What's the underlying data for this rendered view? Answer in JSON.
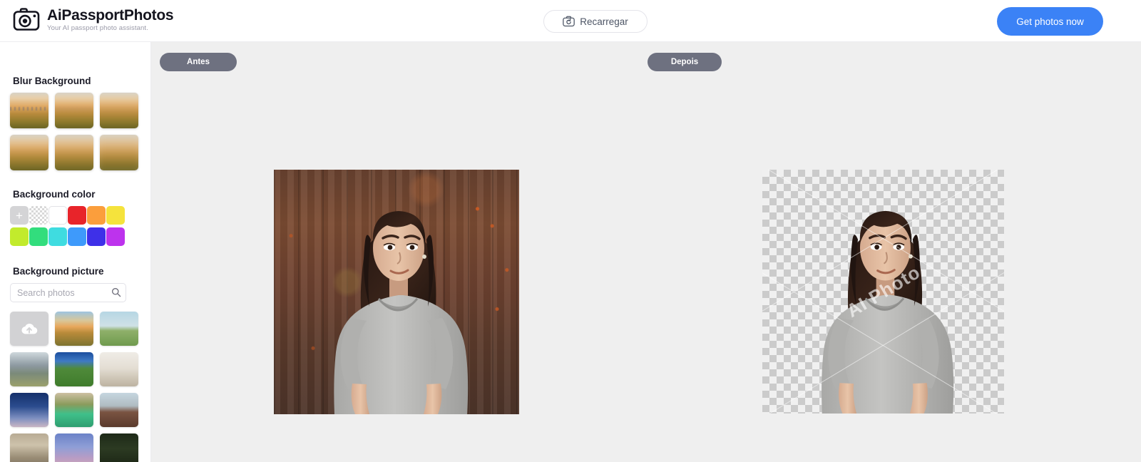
{
  "header": {
    "brand_title": "AiPassportPhotos",
    "brand_subtitle": "Your AI passport photo assistant.",
    "logo_icon": "camera-icon",
    "reload_label": "Recarregar",
    "reload_icon": "camera-refresh-icon",
    "cta_label": "Get photos now",
    "cta_color": "#3b82f6"
  },
  "sidebar": {
    "blur_section": {
      "title": "Blur Background",
      "thumbnails": [
        {
          "name": "blur-level-1",
          "blur": "0"
        },
        {
          "name": "blur-level-2",
          "blur": "1"
        },
        {
          "name": "blur-level-3",
          "blur": "2"
        },
        {
          "name": "blur-level-4",
          "blur": "3"
        },
        {
          "name": "blur-level-5",
          "blur": "4"
        },
        {
          "name": "blur-level-6",
          "blur": "5"
        }
      ]
    },
    "color_section": {
      "title": "Background color",
      "add_label": "+",
      "swatches": [
        {
          "name": "add-color",
          "type": "plus",
          "color": "#d4d4d6"
        },
        {
          "name": "transparent",
          "type": "transparent",
          "color": "transparent"
        },
        {
          "name": "white",
          "type": "white",
          "color": "#ffffff"
        },
        {
          "name": "red",
          "type": "solid",
          "color": "#e8242a"
        },
        {
          "name": "orange",
          "type": "solid",
          "color": "#fb9e3c"
        },
        {
          "name": "yellow",
          "type": "solid",
          "color": "#f5e33c"
        },
        {
          "name": "lime",
          "type": "solid",
          "color": "#c2eb2c"
        },
        {
          "name": "green",
          "type": "solid",
          "color": "#32dd7d"
        },
        {
          "name": "cyan",
          "type": "solid",
          "color": "#3fdce0"
        },
        {
          "name": "blue",
          "type": "solid",
          "color": "#3e9afb"
        },
        {
          "name": "indigo",
          "type": "solid",
          "color": "#3e30e8"
        },
        {
          "name": "magenta",
          "type": "solid",
          "color": "#bd33ed"
        }
      ]
    },
    "picture_section": {
      "title": "Background picture",
      "search_placeholder": "Search photos",
      "search_value": "",
      "search_icon": "magnifier-icon",
      "upload_icon": "cloud-upload-icon",
      "photos": [
        {
          "name": "upload-tile",
          "type": "upload"
        },
        {
          "name": "photo-sunset-balloons",
          "type": "image",
          "grad": "linear-gradient(to bottom,#9dc4e0 0%,#d8c79a 26%,#e8a75c 44%,#b98b3a 62%,#7d7330 100%)"
        },
        {
          "name": "photo-lone-tree-field",
          "type": "image",
          "grad": "linear-gradient(to bottom,#b6d6e4 0%,#cfe1e6 42%,#8fb06a 56%,#6f9a4e 100%)"
        },
        {
          "name": "photo-mountain-peak",
          "type": "image",
          "grad": "linear-gradient(to bottom,#cfd8dc 0%,#8e9aa2 38%,#7b8a7a 62%,#9aa06c 100%)"
        },
        {
          "name": "photo-green-valley",
          "type": "image",
          "grad": "linear-gradient(to bottom,#1c4e9e 0%,#3f7ac4 26%,#4f8a3a 48%,#3f7c2c 100%)"
        },
        {
          "name": "photo-interior-shelf",
          "type": "image",
          "grad": "linear-gradient(to bottom,#efece6 0%,#e4ded4 46%,#cfc7b8 74%,#bdb3a2 100%)"
        },
        {
          "name": "photo-moon-night-sky",
          "type": "image",
          "grad": "linear-gradient(to bottom,#15306b 0%,#2b4c8e 40%,#7d8fc0 74%,#c9b6c4 100%)"
        },
        {
          "name": "photo-green-car-tree",
          "type": "image",
          "grad": "linear-gradient(to bottom,#cdbfa2 0%,#8a9b5c 34%,#3fc08a 62%,#2f9e70 100%)"
        },
        {
          "name": "photo-desert-plain",
          "type": "image",
          "grad": "linear-gradient(to bottom,#c6d6e0 0%,#b0bcc2 38%,#7a5442 56%,#5a3a2c 100%)"
        },
        {
          "name": "photo-window-interior",
          "type": "image",
          "grad": "linear-gradient(to bottom,#b8ab94 0%,#cdc2ab 34%,#9a8d76 70%,#7d7260 100%)"
        },
        {
          "name": "photo-purple-sky",
          "type": "image",
          "grad": "linear-gradient(to bottom,#6b82c8 0%,#8f9ed6 40%,#b99cc4 72%,#d0a9b6 100%)"
        },
        {
          "name": "photo-dark-foliage",
          "type": "image",
          "grad": "linear-gradient(to bottom,#1e2a18 0%,#2c3a22 44%,#1a2414 100%)"
        }
      ]
    }
  },
  "canvas": {
    "before_label": "Antes",
    "after_label": "Depois",
    "pill_color": "#6e7180",
    "before_image_alt": "woman in gray top against rusty brown wall",
    "after_image_alt": "woman in gray top with transparent background",
    "watermark_text": "AI Photo"
  }
}
